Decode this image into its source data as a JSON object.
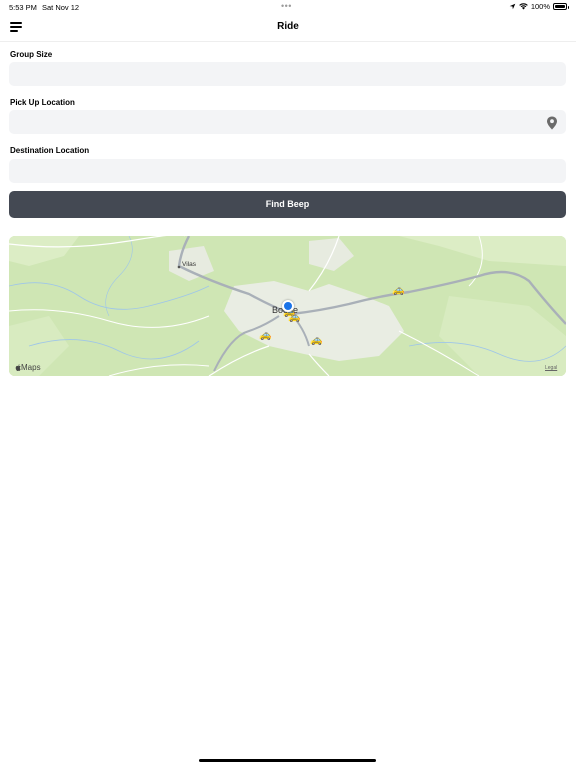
{
  "status_bar": {
    "time": "5:53 PM",
    "date": "Sat Nov 12",
    "battery_percent": "100%",
    "battery_level": 1.0,
    "icons": [
      "location-arrow-icon",
      "wifi-icon",
      "battery-icon"
    ]
  },
  "header": {
    "title": "Ride",
    "menu_icon": "hamburger-menu-icon"
  },
  "form": {
    "group_size": {
      "label": "Group Size",
      "value": "",
      "placeholder": ""
    },
    "pickup": {
      "label": "Pick Up Location",
      "value": "",
      "placeholder": "",
      "icon": "location-pin-icon"
    },
    "destination": {
      "label": "Destination Location",
      "value": "",
      "placeholder": ""
    },
    "find_button_label": "Find Beep"
  },
  "map": {
    "town_label": "Vilas",
    "city_label": "Boone",
    "brand": "Maps",
    "legal_label": "Legal",
    "beep_count": 5
  },
  "colors": {
    "button_bg": "#444953",
    "field_bg": "#f3f4f6",
    "user_dot": "#1a73e8",
    "map_land": "#cfe6b4"
  }
}
